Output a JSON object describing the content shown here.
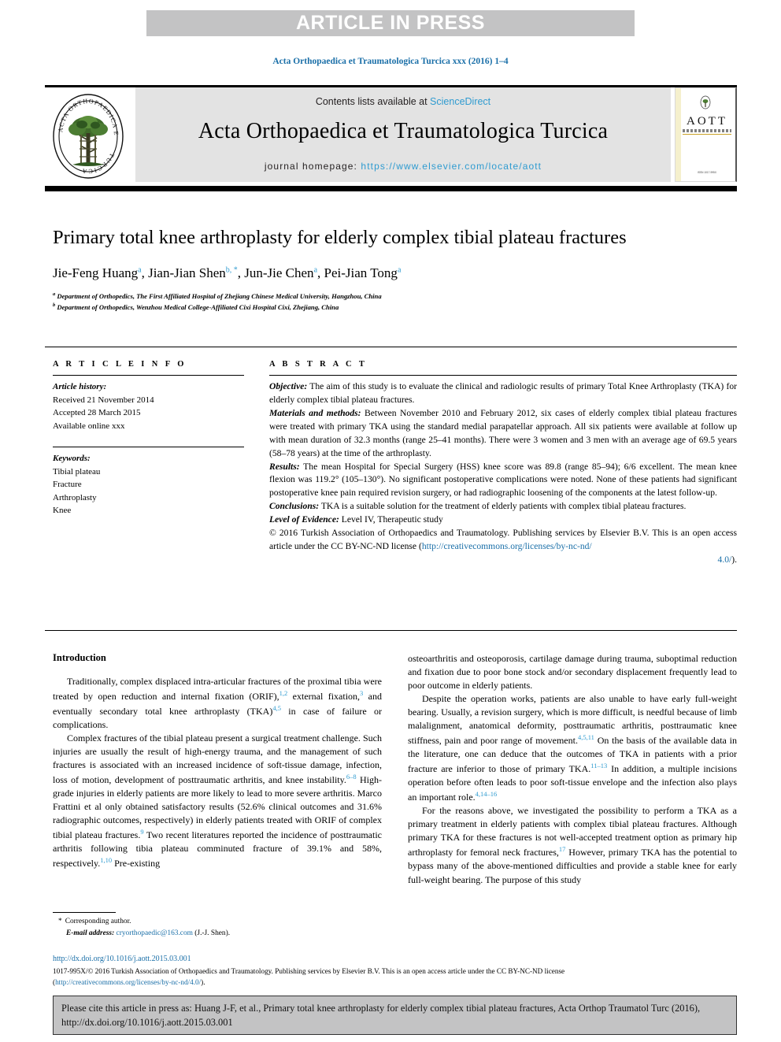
{
  "banner": {
    "text": "ARTICLE IN PRESS"
  },
  "journal_citation": "Acta Orthopaedica et Traumatologica Turcica xxx (2016) 1–4",
  "masthead": {
    "contents_prefix": "Contents lists available at ",
    "contents_link": "ScienceDirect",
    "journal_title": "Acta Orthopaedica et Traumatologica Turcica",
    "homepage_label": "journal homepage: ",
    "homepage_url": "https://www.elsevier.com/locate/aott",
    "cover_title": "AOTT",
    "cover_footer": "ISSN\n1017-995X"
  },
  "article": {
    "title": "Primary total knee arthroplasty for elderly complex tibial plateau fractures",
    "authors": [
      {
        "name": "Jie-Feng Huang",
        "marks": "a"
      },
      {
        "name": "Jian-Jian Shen",
        "marks": "b, *"
      },
      {
        "name": "Jun-Jie Chen",
        "marks": "a"
      },
      {
        "name": "Pei-Jian Tong",
        "marks": "a"
      }
    ],
    "affiliations": [
      {
        "mark": "a",
        "text": "Department of Orthopedics, The First Affiliated Hospital of Zhejiang Chinese Medical University, Hangzhou, China"
      },
      {
        "mark": "b",
        "text": "Department of Orthopedics, Wenzhou Medical College-Affiliated Cixi Hospital Cixi, Zhejiang, China"
      }
    ]
  },
  "article_info": {
    "heading": "A R T I C L E  I N F O",
    "history_label": "Article history:",
    "history": [
      "Received 21 November 2014",
      "Accepted 28 March 2015",
      "Available online xxx"
    ],
    "keywords_label": "Keywords:",
    "keywords": [
      "Tibial plateau",
      "Fracture",
      "Arthroplasty",
      "Knee"
    ]
  },
  "abstract": {
    "heading": "A B S T R A C T",
    "sections": [
      {
        "label": "Objective:",
        "text": " The aim of this study is to evaluate the clinical and radiologic results of primary Total Knee Arthroplasty (TKA) for elderly complex tibial plateau fractures."
      },
      {
        "label": "Materials and methods:",
        "text": " Between November 2010 and February 2012, six cases of elderly complex tibial plateau fractures were treated with primary TKA using the standard medial parapatellar approach. All six patients were available at follow up with mean duration of 32.3 months (range 25–41 months). There were 3 women and 3 men with an average age of 69.5 years (58–78 years) at the time of the arthroplasty."
      },
      {
        "label": "Results:",
        "text": " The mean Hospital for Special Surgery (HSS) knee score was 89.8 (range 85–94); 6/6 excellent. The mean knee flexion was 119.2° (105–130°). No significant postoperative complications were noted. None of these patients had significant postoperative knee pain required revision surgery, or had radiographic loosening of the components at the latest follow-up."
      },
      {
        "label": "Conclusions:",
        "text": " TKA is a suitable solution for the treatment of elderly patients with complex tibial plateau fractures."
      },
      {
        "label": "Level of Evidence:",
        "text": " Level IV, Therapeutic study"
      }
    ],
    "copyright_prefix": "© 2016 Turkish Association of Orthopaedics and Traumatology. Publishing services by Elsevier B.V. This is an open access article under the CC BY-NC-ND license (",
    "copyright_link": "http://creativecommons.org/licenses/by-nc-nd/",
    "copyright_link_tail": "4.0/",
    "copyright_suffix": ")."
  },
  "introduction": {
    "heading": "Introduction",
    "left_paragraphs": [
      {
        "runs": [
          {
            "t": "Traditionally, complex displaced intra-articular fractures of the proximal tibia were treated by open reduction and internal fixation (ORIF),"
          },
          {
            "sup": "1,2"
          },
          {
            "t": " external fixation,"
          },
          {
            "sup": "3"
          },
          {
            "t": " and eventually secondary total knee arthroplasty (TKA)"
          },
          {
            "sup": "4,5"
          },
          {
            "t": " in case of failure or complications."
          }
        ]
      },
      {
        "runs": [
          {
            "t": "Complex fractures of the tibial plateau present a surgical treatment challenge. Such injuries are usually the result of high-energy trauma, and the management of such fractures is associated with an increased incidence of soft-tissue damage, infection, loss of motion, development of posttraumatic arthritis, and knee instability."
          },
          {
            "sup": "6–8"
          },
          {
            "t": " High-grade injuries in elderly patients are more likely to lead to more severe arthritis. Marco Frattini et al only obtained satisfactory results (52.6% clinical outcomes and 31.6% radiographic outcomes, respectively) in elderly patients treated with ORIF of complex tibial plateau fractures."
          },
          {
            "sup": "9"
          },
          {
            "t": " Two recent literatures reported the incidence of posttraumatic arthritis following tibia plateau comminuted fracture of 39.1% and 58%, respectively."
          },
          {
            "sup": "1,10"
          },
          {
            "t": " Pre-existing"
          }
        ]
      }
    ],
    "right_paragraphs": [
      {
        "runs": [
          {
            "t": "osteoarthritis and osteoporosis, cartilage damage during trauma, suboptimal reduction and fixation due to poor bone stock and/or secondary displacement frequently lead to poor outcome in elderly patients."
          }
        ],
        "indent": false
      },
      {
        "runs": [
          {
            "t": "Despite the operation works, patients are also unable to have early full-weight bearing. Usually, a revision surgery, which is more difficult, is needful because of limb malalignment, anatomical deformity, posttraumatic arthritis, posttraumatic knee stiffness, pain and poor range of movement."
          },
          {
            "sup": "4,5,11"
          },
          {
            "t": " On the basis of the available data in the literature, one can deduce that the outcomes of TKA in patients with a prior fracture are inferior to those of primary TKA."
          },
          {
            "sup": "11–13"
          },
          {
            "t": " In addition, a multiple incisions operation before often leads to poor soft-tissue envelope and the infection also plays an important role."
          },
          {
            "sup": "4,14–16"
          }
        ],
        "indent": true
      },
      {
        "runs": [
          {
            "t": "For the reasons above, we investigated the possibility to perform a TKA as a primary treatment in elderly patients with complex tibial plateau fractures. Although primary TKA for these fractures is not well-accepted treatment option as primary hip arthroplasty for femoral neck fractures,"
          },
          {
            "sup": "17"
          },
          {
            "t": " However, primary TKA has the potential to bypass many of the above-mentioned difficulties and provide a stable knee for early full-weight bearing. The purpose of this study"
          }
        ],
        "indent": true
      }
    ]
  },
  "footnote": {
    "star": "*",
    "corresponding": "Corresponding author.",
    "email_label": "E-mail address:",
    "email": "cryorthopaedic@163.com",
    "email_owner": "(J.-J. Shen)."
  },
  "bottom": {
    "doi": "http://dx.doi.org/10.1016/j.aott.2015.03.001",
    "issn_line": "1017-995X/© 2016 Turkish Association of Orthopaedics and Traumatology. Publishing services by Elsevier B.V. This is an open access article under the CC BY-NC-ND license",
    "license_open": "(",
    "license_link": "http://creativecommons.org/licenses/by-nc-nd/4.0/",
    "license_close": ")."
  },
  "cite_box": {
    "text": "Please cite this article in press as: Huang J-F, et al., Primary total knee arthroplasty for elderly complex tibial plateau fractures, Acta Orthop Traumatol Turc (2016), http://dx.doi.org/10.1016/j.aott.2015.03.001"
  },
  "colors": {
    "link_blue": "#1a6fa8",
    "sciencedirect_blue": "#2f9bd0",
    "banner_grey": "#c3c3c4",
    "masthead_grey": "#e3e3e3"
  }
}
